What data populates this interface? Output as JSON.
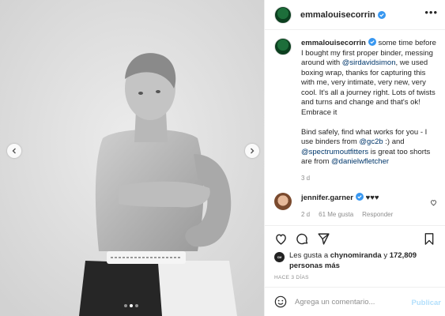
{
  "post": {
    "author": "emmalouisecorrin",
    "more_label": "•••",
    "media": {
      "slide_count": 3,
      "active_slide": 2
    },
    "caption": {
      "author": "emmalouisecorrin",
      "text_1": " some time before I bought my first proper binder, messing around with ",
      "mention_1": "@sirdavidsimon",
      "text_2": ", we used boxing wrap, thanks for capturing this with me, very intimate, very new, very cool. It's all a journey right. Lots of twists and turns and change and that's ok! Embrace it",
      "text_3": "Bind safely, find what works for you - I use binders from ",
      "mention_2": "@gc2b",
      "text_4": " :) and ",
      "mention_3": "@spectrumoutfitters",
      "text_5": " is great too shorts are from ",
      "mention_4": "@danielwfletcher",
      "date": "3 d"
    },
    "comment": {
      "author": "jennifer.garner",
      "text": " ♥♥♥",
      "date": "2 d",
      "likes": "61 Me gusta",
      "reply": "Responder"
    },
    "likes": {
      "prefix": "Les gusta a ",
      "user": "chynomiranda",
      "middle": " y ",
      "count": "172,809 personas más"
    },
    "ago": "HACE 3 DÍAS",
    "add_comment": {
      "placeholder": "Agrega un comentario...",
      "publish": "Publicar"
    }
  },
  "colors": {
    "verified": "#3897f0",
    "link": "#00376b",
    "publish_disabled": "#b2dffc"
  },
  "icons": [
    "chevron-left-icon",
    "chevron-right-icon",
    "verified-icon",
    "heart-icon",
    "comment-icon",
    "share-icon",
    "bookmark-icon",
    "emoji-icon"
  ]
}
